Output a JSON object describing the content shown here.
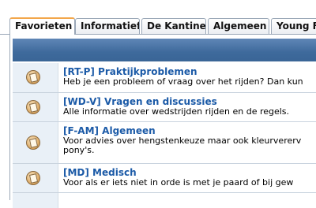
{
  "tabs": [
    {
      "label": "Favorieten",
      "active": true
    },
    {
      "label": "Informatief",
      "active": false
    },
    {
      "label": "De Kantine",
      "active": false
    },
    {
      "label": "Algemeen",
      "active": false
    },
    {
      "label": "Young F",
      "active": false
    }
  ],
  "forums": [
    {
      "title": "[RT-P] Praktijkproblemen",
      "description": "Heb je een probleem of vraag over het rijden? Dan kun"
    },
    {
      "title": "[WD-V] Vragen en discussies",
      "description": "Alle informatie over wedstrijden rijden en de regels."
    },
    {
      "title": "[F-AM] Algemeen",
      "description_line1": "Voor advies over hengstenkeuze maar ook kleurvererv",
      "description_line2": "pony's."
    },
    {
      "title": "[MD] Medisch",
      "description": "Voor als er iets niet in orde is met je paard of bij gew"
    }
  ],
  "colors": {
    "header_blue": "#3e6a9c",
    "tab_active_accent": "#f3a64a",
    "link_blue": "#1b5aa7"
  },
  "icons": {
    "forum": "forum-folder-icon"
  }
}
